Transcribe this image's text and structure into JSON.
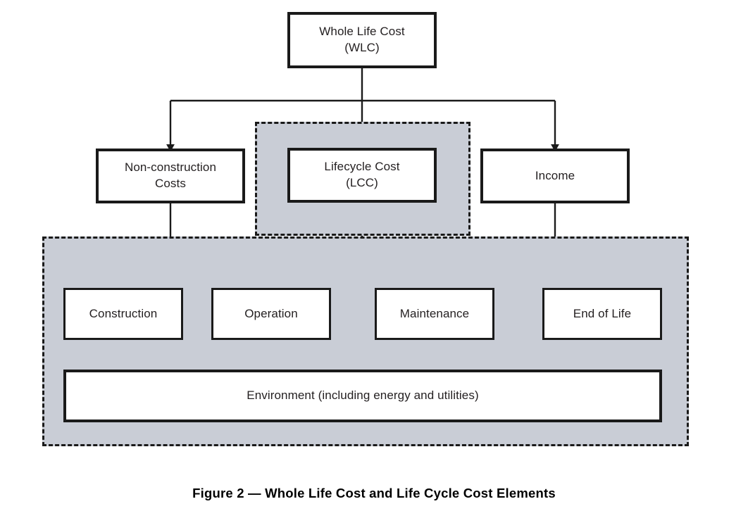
{
  "figure": {
    "caption": "Figure 2 — Whole Life Cost and Life Cycle Cost Elements"
  },
  "colors": {
    "region_fill": "#c9cdd6",
    "stroke": "#1a1a1a",
    "box_fill": "#ffffff",
    "text": "#231f20",
    "page_background": "#ffffff"
  },
  "nodes": {
    "whole_life_cost": {
      "label": "Whole Life Cost\n(WLC)",
      "level": "root"
    },
    "non_construction_costs": {
      "label": "Non-construction\nCosts",
      "level": "branch"
    },
    "lifecycle_cost": {
      "label": "Lifecycle Cost\n(LCC)",
      "level": "branch"
    },
    "income": {
      "label": "Income",
      "level": "branch"
    },
    "construction": {
      "label": "Construction",
      "level": "leaf"
    },
    "operation": {
      "label": "Operation",
      "level": "leaf"
    },
    "maintenance": {
      "label": "Maintenance",
      "level": "leaf"
    },
    "end_of_life": {
      "label": "End of Life",
      "level": "leaf"
    },
    "environment": {
      "label": "Environment (including energy and utilities)",
      "level": "leaf"
    }
  },
  "regions": {
    "lcc_region": {
      "name": "Lifecycle Cost grouping",
      "style": "dashed-grey"
    },
    "lcc_elements_region": {
      "name": "Lifecycle Cost elements grouping",
      "style": "dashed-grey"
    }
  }
}
